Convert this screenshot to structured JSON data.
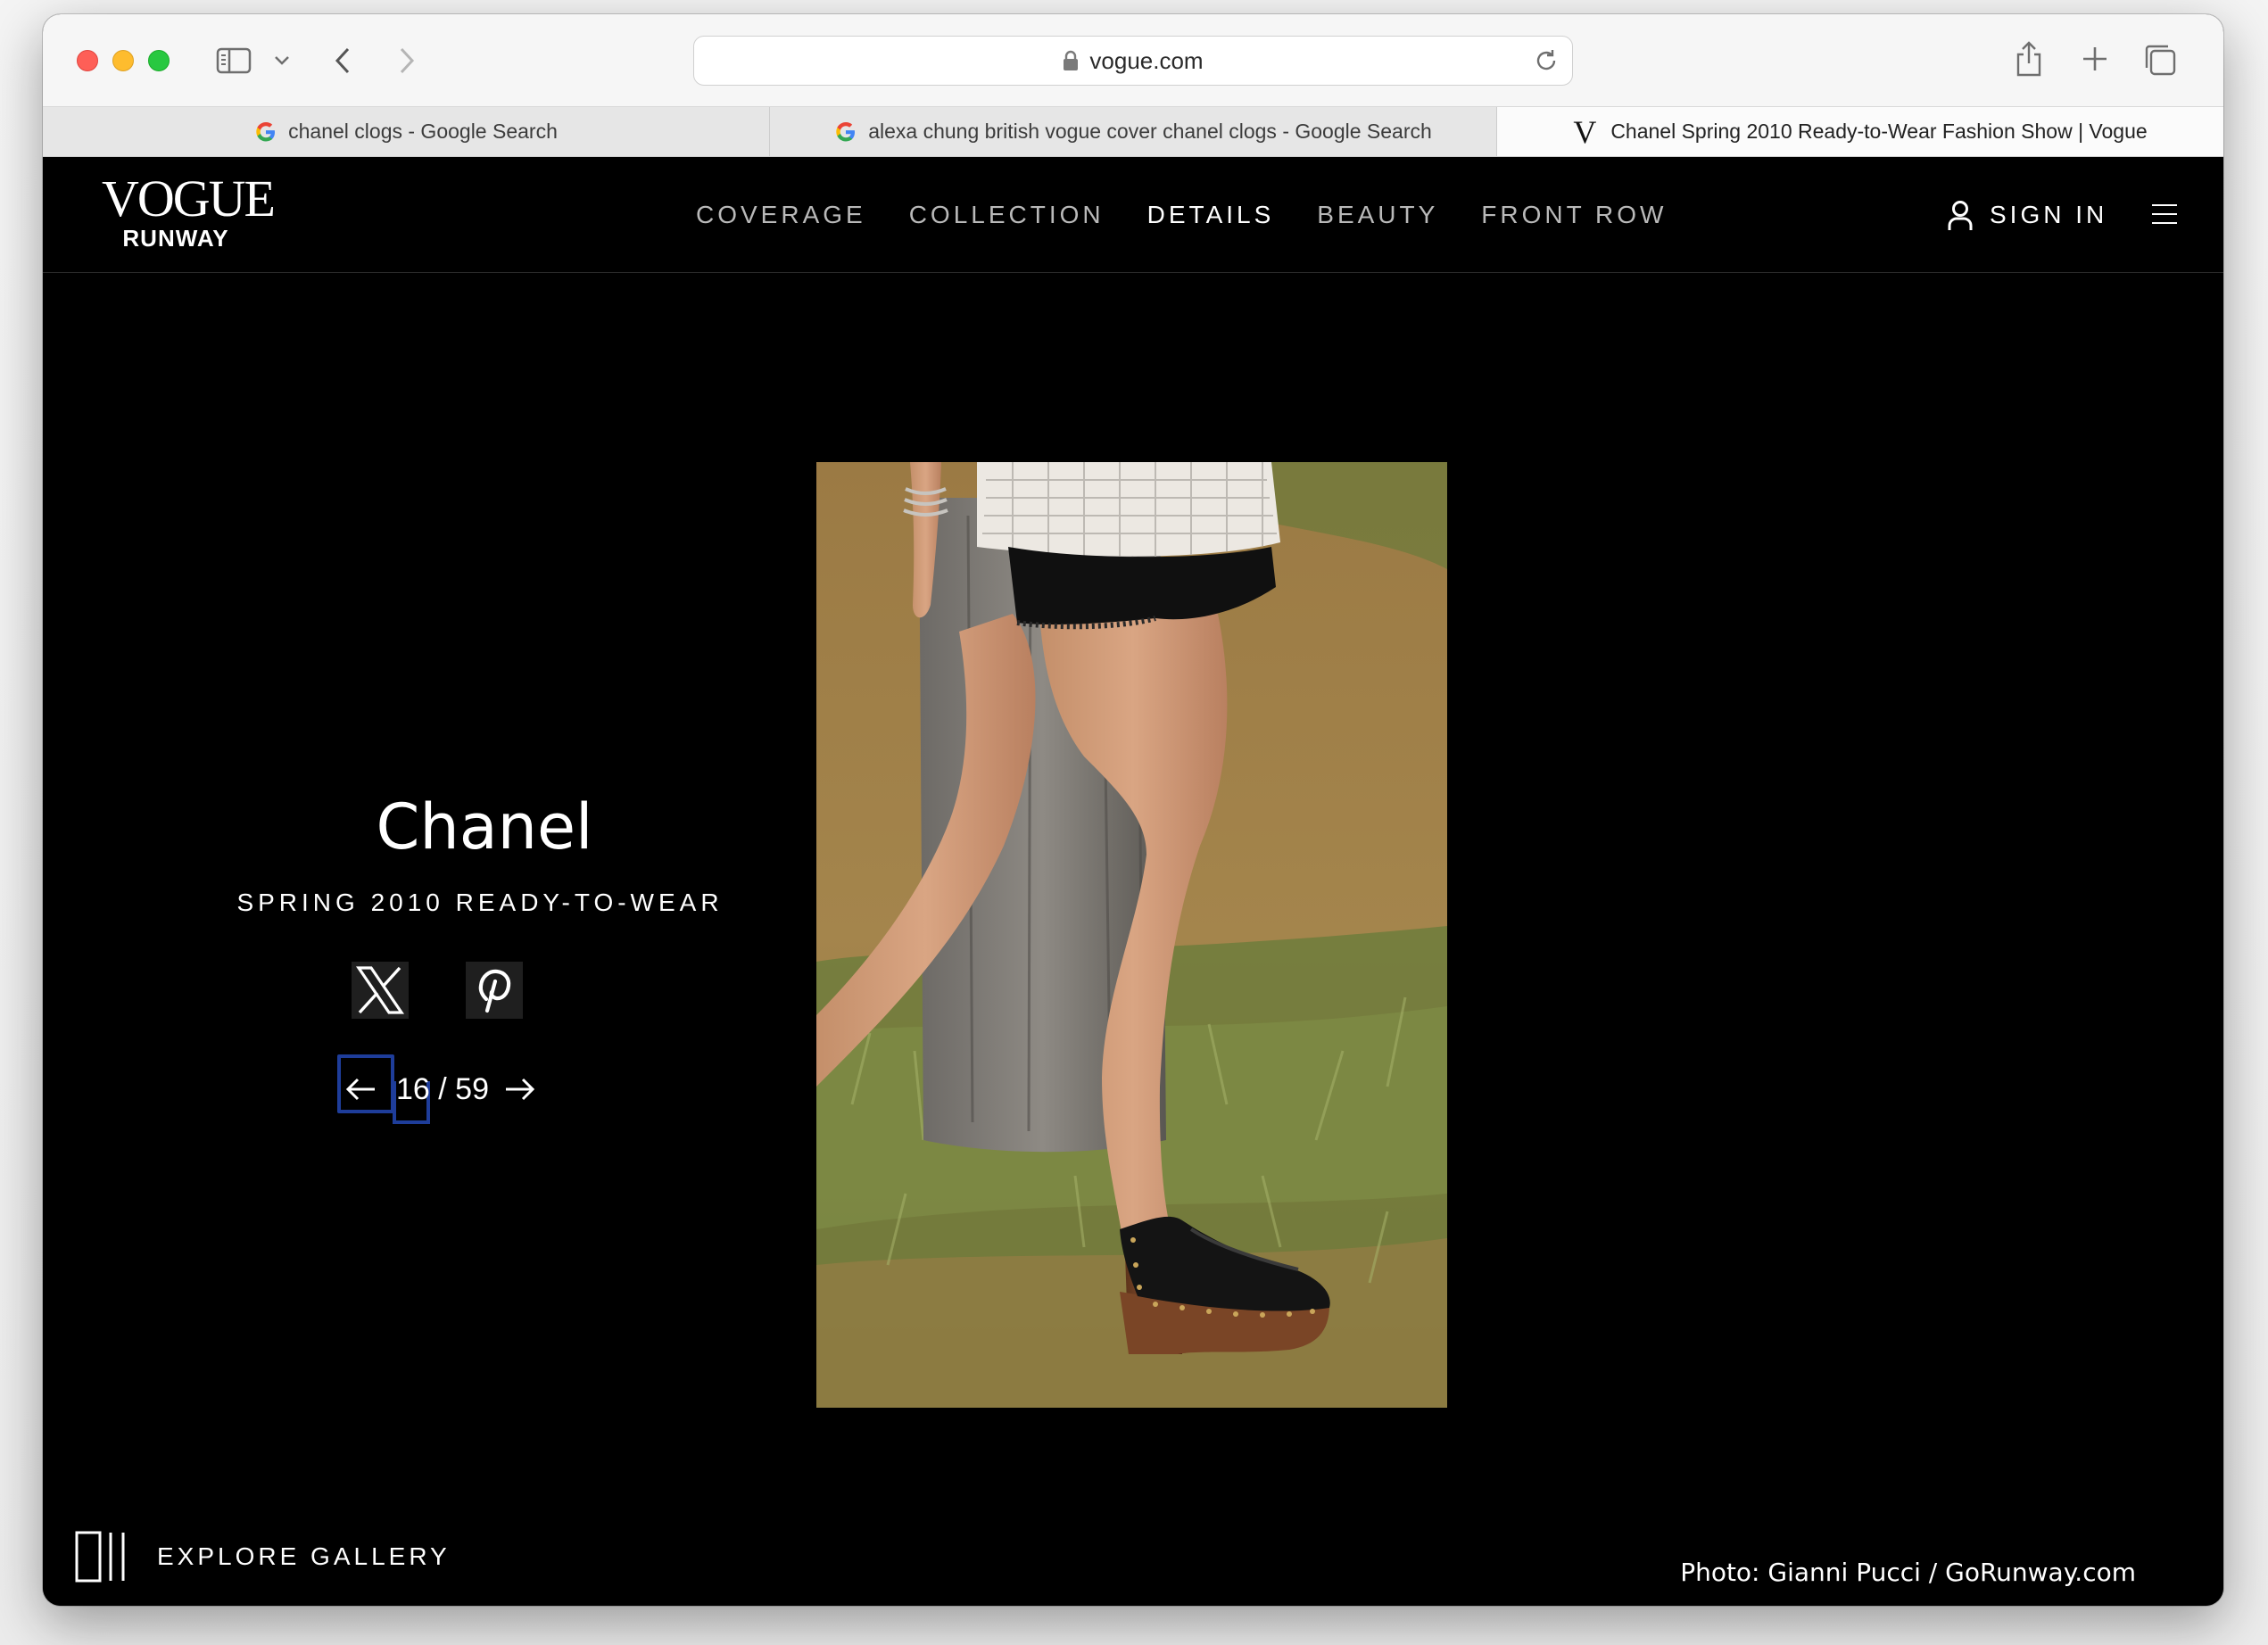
{
  "browser": {
    "address": {
      "domain": "vogue.com"
    },
    "tabs": [
      {
        "title": "chanel clogs - Google Search",
        "favicon": "google-g-icon"
      },
      {
        "title": "alexa chung british vogue cover chanel clogs - Google Search",
        "favicon": "google-g-icon"
      },
      {
        "title": "Chanel Spring 2010 Ready-to-Wear Fashion Show | Vogue",
        "favicon": "vogue-v-icon",
        "favicon_text": "V"
      }
    ]
  },
  "site": {
    "logo": {
      "main": "VOGUE",
      "sub": "RUNWAY"
    },
    "nav": [
      {
        "label": "COVERAGE"
      },
      {
        "label": "COLLECTION"
      },
      {
        "label": "DETAILS",
        "active": true
      },
      {
        "label": "BEAUTY"
      },
      {
        "label": "FRONT ROW"
      }
    ],
    "sign_in": "SIGN IN"
  },
  "show": {
    "designer": "Chanel",
    "season": "SPRING 2010 READY-TO-WEAR",
    "pager": {
      "current": "16",
      "separator": "/",
      "total": "59",
      "display": "16 / 59"
    }
  },
  "gallery": {
    "explore_label": "EXPLORE GALLERY",
    "photo_credit": "Photo: Gianni Pucci / GoRunway.com"
  },
  "colors": {
    "page_bg": "#000000",
    "text": "#ffffff",
    "nav_inactive": "#b9b9b9",
    "focus_ring": "#1e3d9a"
  }
}
